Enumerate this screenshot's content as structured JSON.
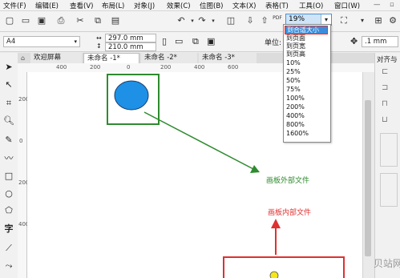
{
  "menu": [
    "文件(F)",
    "编辑(E)",
    "查看(V)",
    "布局(L)",
    "对象(J)",
    "效果(C)",
    "位图(B)",
    "文本(X)",
    "表格(T)",
    "工具(O)",
    "窗口(W)"
  ],
  "toolbar": {
    "pdf_label": "PDF",
    "zoom_value": "19%"
  },
  "propbar": {
    "page_size": "A4",
    "width": "297.0 mm",
    "height": "210.0 mm",
    "units_label": "单位:",
    "nudge_value": ".1 mm"
  },
  "tabs": [
    "欢迎屏幕",
    "未命名 -1*",
    "未命名 -2*",
    "未命名 -3*"
  ],
  "ruler": {
    "h": [
      "400",
      "200",
      "0",
      "200",
      "400",
      "600"
    ],
    "v": [
      "200",
      "0",
      "200",
      "400"
    ]
  },
  "zoom_options": [
    "到合适大小",
    "到页面",
    "到页宽",
    "到页高",
    "10%",
    "25%",
    "50%",
    "75%",
    "100%",
    "200%",
    "400%",
    "800%",
    "1600%"
  ],
  "docker": {
    "title": "对齐与"
  },
  "annotations": {
    "outside": "画板外部文件",
    "inside": "画板内部文件"
  },
  "colors": {
    "accent_green": "#2e8b2e",
    "accent_red": "#e03030",
    "ellipse_fill": "#1e90e6",
    "select_blue": "#3b8ddb"
  },
  "watermark": "贝站网"
}
